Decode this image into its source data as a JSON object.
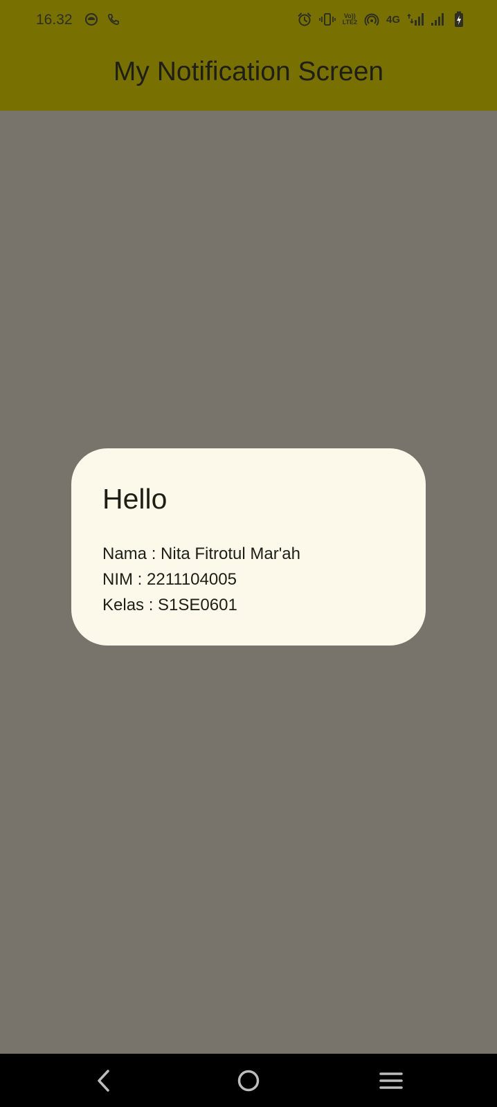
{
  "status_bar": {
    "time": "16.32",
    "left_icons": [
      "notification-app-icon",
      "phone-call-icon"
    ],
    "right_icons": [
      "alarm-icon",
      "vibrate-icon",
      "volte-lte2-icon",
      "hotspot-icon",
      "signal-4g-icon",
      "signal-icon",
      "battery-charging-icon"
    ],
    "network_label": "4G",
    "volte_top": "Vo))",
    "volte_bottom": "LTE2"
  },
  "app_bar": {
    "title": "My Notification Screen",
    "color": "#787000"
  },
  "dialog": {
    "title": "Hello",
    "lines": [
      "Nama : Nita Fitrotul Mar'ah",
      "NIM : 2211104005",
      "Kelas : S1SE0601"
    ],
    "background": "#fdf9ea"
  },
  "nav_bar": {
    "buttons": [
      "back-icon",
      "home-icon",
      "recents-icon"
    ]
  },
  "scrim_color": "#78746c"
}
